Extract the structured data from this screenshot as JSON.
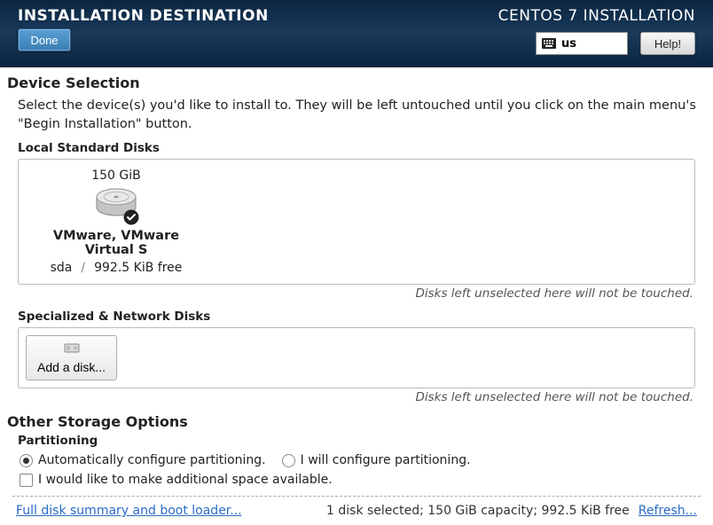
{
  "header": {
    "title": "INSTALLATION DESTINATION",
    "done_label": "Done",
    "installer_title": "CENTOS 7 INSTALLATION",
    "keyboard_layout": "us",
    "help_label": "Help!"
  },
  "device_selection": {
    "title": "Device Selection",
    "description": "Select the device(s) you'd like to install to.  They will be left untouched until you click on the main menu's \"Begin Installation\" button.",
    "local_disks_label": "Local Standard Disks",
    "disks": [
      {
        "size": "150 GiB",
        "name": "VMware, VMware Virtual S",
        "device": "sda",
        "free": "992.5 KiB free",
        "selected": true
      }
    ],
    "unselected_hint": "Disks left unselected here will not be touched.",
    "specialized_label": "Specialized & Network Disks",
    "add_disk_label": "Add a disk..."
  },
  "storage_options": {
    "title": "Other Storage Options",
    "partitioning_label": "Partitioning",
    "auto_label": "Automatically configure partitioning.",
    "manual_label": "I will configure partitioning.",
    "auto_selected": true,
    "reclaim_label": "I would like to make additional space available."
  },
  "footer": {
    "summary_link": "Full disk summary and boot loader...",
    "status": "1 disk selected; 150 GiB capacity; 992.5 KiB free",
    "refresh_link": "Refresh..."
  }
}
